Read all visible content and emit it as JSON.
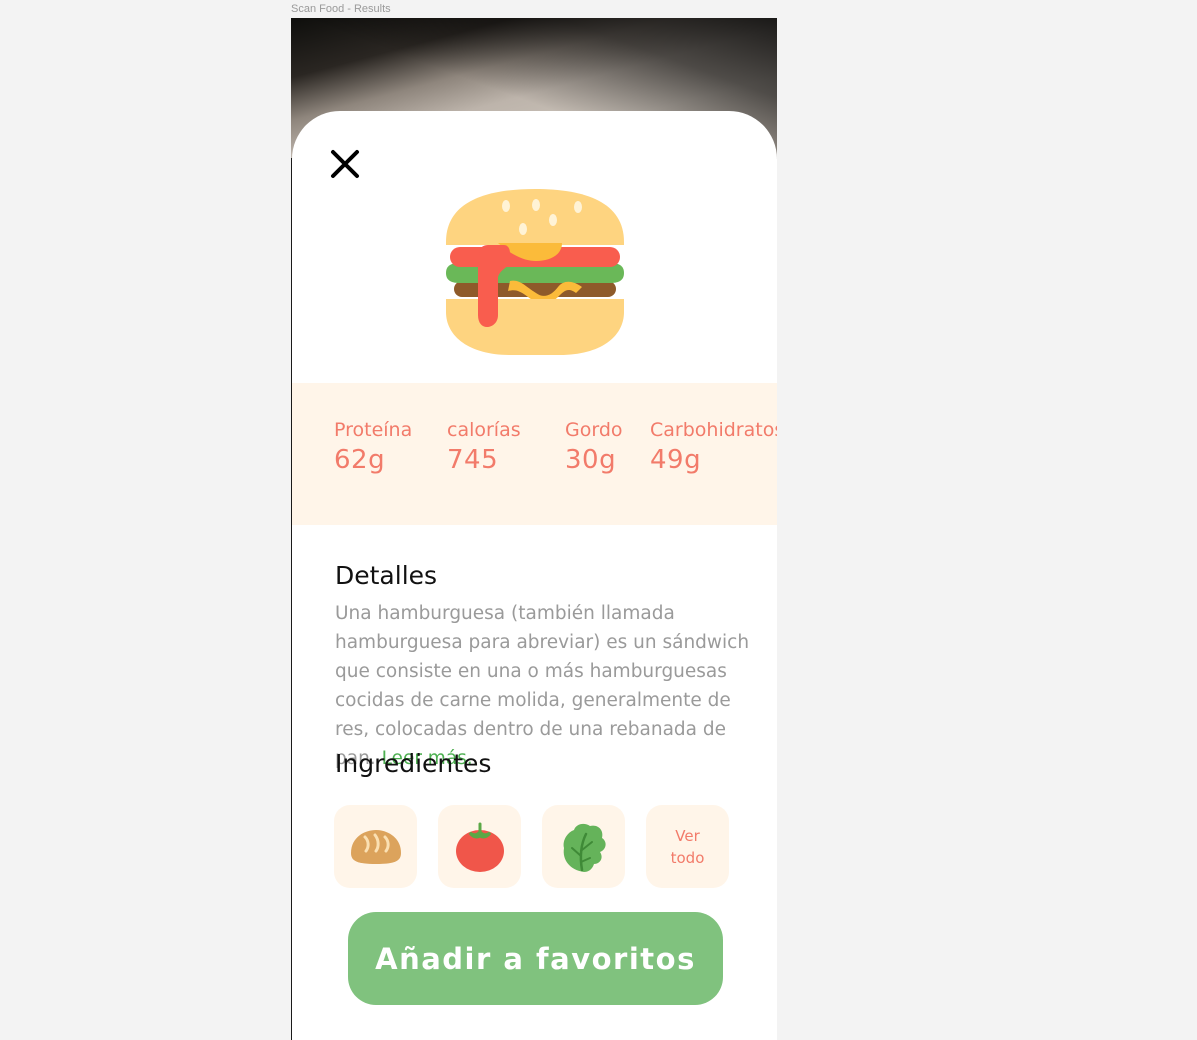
{
  "frame": {
    "label": "Scan Food - Results"
  },
  "close_icon": "close-icon",
  "food_image": "hamburger-illustration",
  "nutrition": [
    {
      "label": "Proteína",
      "value": "62g"
    },
    {
      "label": "calorías",
      "value": "745"
    },
    {
      "label": "Gordo",
      "value": "30g"
    },
    {
      "label": "Carbohidratos",
      "value": "49g"
    }
  ],
  "details": {
    "title": "Detalles",
    "text": "Una hamburguesa (también llamada hamburguesa para abreviar) es un sándwich que consiste en una o más hamburguesas cocidas de carne molida, generalmente de res, colocadas dentro de una rebanada de pan.",
    "read_more": "Leer más..."
  },
  "ingredients": {
    "title": "Ingredientes",
    "items": [
      "bread-icon",
      "tomato-icon",
      "lettuce-icon"
    ],
    "see_all_line1": "Ver",
    "see_all_line2": "todo"
  },
  "favorite_button": {
    "label": "Añadir a favoritos"
  },
  "colors": {
    "accent_coral": "#f27b6a",
    "button_green": "#80c27e",
    "link_green": "#4caf50",
    "panel_cream": "#fff5e9"
  }
}
